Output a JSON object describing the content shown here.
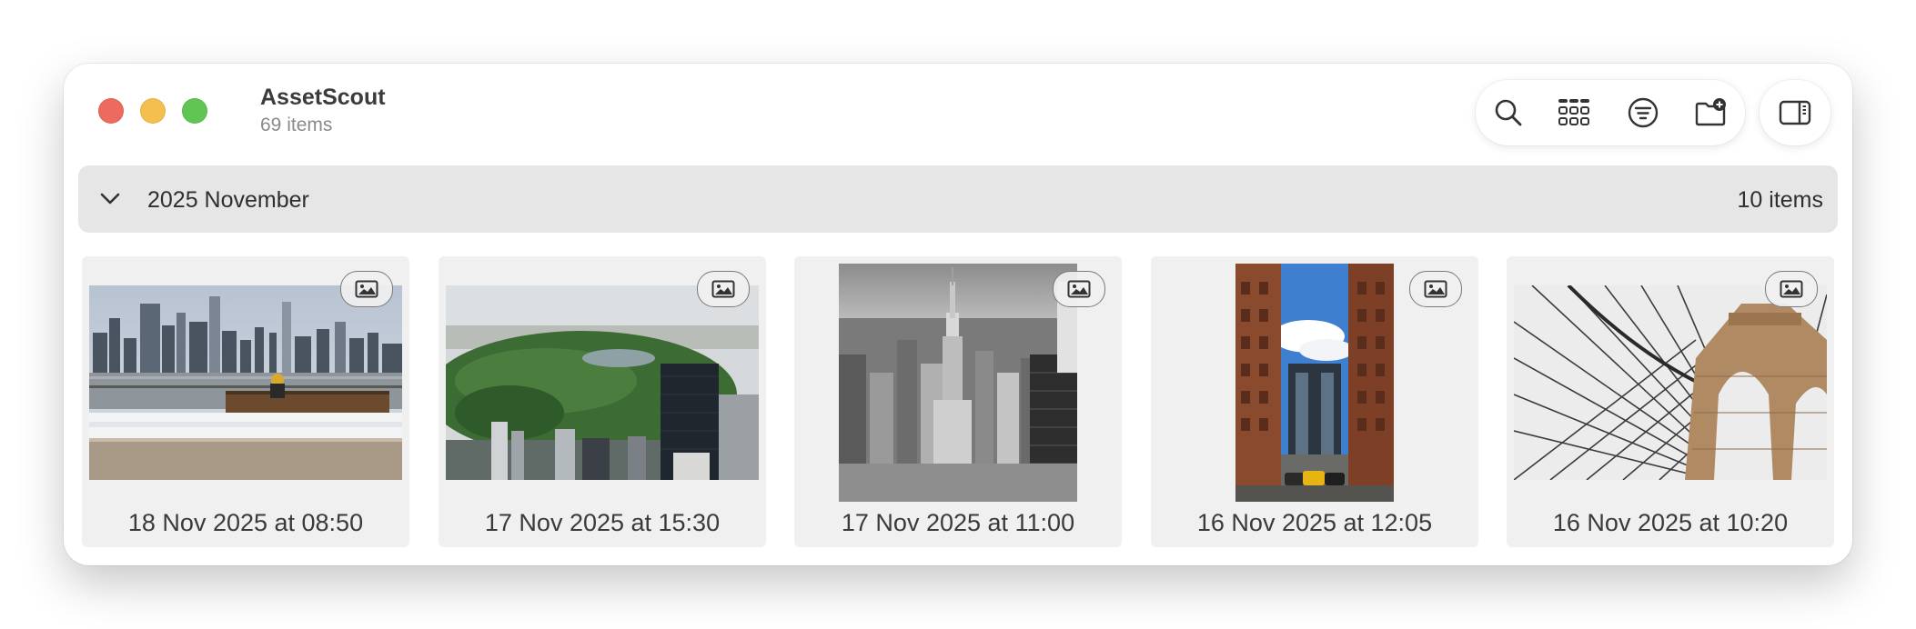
{
  "window": {
    "title": "AssetScout",
    "subtitle": "69 items"
  },
  "toolbar": {
    "buttons": [
      {
        "icon": "magnifyingglass"
      },
      {
        "icon": "square-grid-3x2"
      },
      {
        "icon": "line-3-horizontal-decrease-circle"
      },
      {
        "icon": "folder-badge-plus"
      },
      {
        "icon": "sidebar-right"
      }
    ]
  },
  "section": {
    "title": "2025 November",
    "count": "10 items"
  },
  "assets": [
    {
      "date": "18 Nov 2025 at 08:50",
      "type": "image"
    },
    {
      "date": "17 Nov 2025 at 15:30",
      "type": "image"
    },
    {
      "date": "17 Nov 2025 at 11:00",
      "type": "image"
    },
    {
      "date": "16 Nov 2025 at 12:05",
      "type": "image"
    },
    {
      "date": "16 Nov 2025 at 10:20",
      "type": "image"
    }
  ]
}
